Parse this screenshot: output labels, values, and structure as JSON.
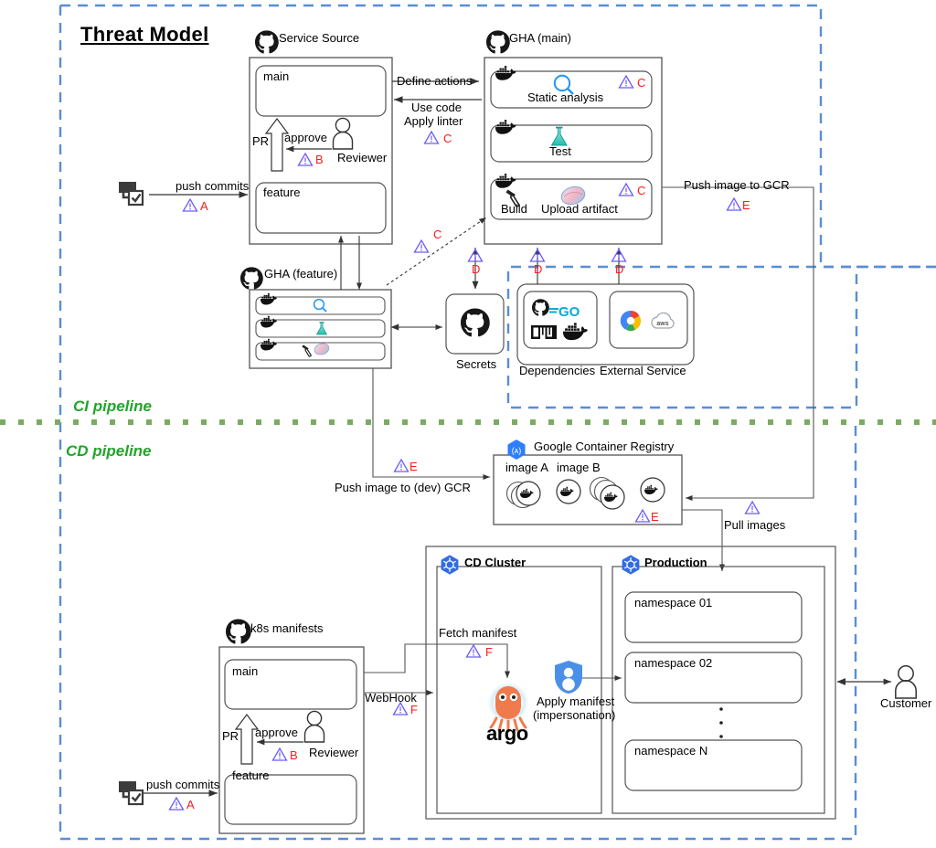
{
  "diagram": {
    "title": "Threat Model",
    "pipelines": [
      {
        "id": "ci",
        "label": "CI pipeline"
      },
      {
        "id": "cd",
        "label": "CD pipeline"
      }
    ],
    "colors": {
      "trust_boundary": "#5b8cd6",
      "pipeline_divider": "#7aab62",
      "pipeline_label": "#22a52a",
      "threat_marker": "#6a5cff",
      "threat_letter": "#ff1a1a",
      "box_stroke": "#555555",
      "kubernetes_blue": "#326ce5",
      "argo_orange": "#ef7b4d",
      "shield_blue": "#4a90e8",
      "docker_blue": "#1d91d0",
      "go_cyan": "#00add8"
    }
  },
  "groups": {
    "service_source": {
      "icon": "github-icon",
      "label": "Service Source",
      "branches": [
        {
          "name": "main"
        },
        {
          "name": "feature"
        }
      ],
      "pr_label": "PR",
      "approve_label": "approve",
      "reviewer_label": "Reviewer",
      "threat": {
        "marker": "warning-triangle-icon",
        "letter": "B"
      }
    },
    "gha_main": {
      "icon": "github-icon",
      "label": "GHA (main)",
      "jobs": [
        {
          "runner": "docker-icon",
          "icon": "magnifier-icon",
          "label": "Static analysis",
          "threat": {
            "marker": "warning-triangle-icon",
            "letter": "C"
          }
        },
        {
          "runner": "docker-icon",
          "icon": "flask-icon",
          "label": "Test",
          "threat": null
        },
        {
          "runner": "docker-icon",
          "icon": "hammer-icon",
          "label": "Build",
          "icon2": "upload-artifact-icon",
          "label2": "Upload artifact",
          "threat": {
            "marker": "warning-triangle-icon",
            "letter": "C"
          }
        }
      ]
    },
    "gha_feature": {
      "icon": "github-icon",
      "label": "GHA (feature)",
      "jobs": [
        {
          "runner": "docker-icon",
          "icon": "magnifier-icon"
        },
        {
          "runner": "docker-icon",
          "icon": "flask-icon"
        },
        {
          "runner": "docker-icon",
          "icon": "hammer-icon",
          "icon2": "upload-artifact-icon"
        }
      ]
    },
    "secrets": {
      "icon": "github-icon",
      "label": "Secrets"
    },
    "dependencies": {
      "label": "Dependencies",
      "icons": [
        "github-icon",
        "golang-icon",
        "npm-icon",
        "docker-icon"
      ]
    },
    "external_service": {
      "label": "External Service",
      "icons": [
        "google-cloud-icon",
        "aws-cloud-icon"
      ]
    },
    "gcr": {
      "icon": "gcr-hexagon-icon",
      "label": "Google Container Registry",
      "image_labels": [
        "image A",
        "image B"
      ],
      "images": [
        "docker-image-stack-icon",
        "docker-image-icon",
        "docker-image-stack-icon",
        "docker-image-icon"
      ],
      "threat": {
        "marker": "warning-triangle-icon",
        "letter": "E"
      }
    },
    "cd_cluster": {
      "icon": "kubernetes-icon",
      "label": "CD Cluster",
      "argo_label": "argo",
      "argo_icon": "argo-octopus-icon"
    },
    "production": {
      "icon": "kubernetes-icon",
      "label": "Production",
      "namespaces": [
        {
          "name": "namespace 01"
        },
        {
          "name": "namespace 02"
        },
        {
          "name": "namespace N"
        }
      ],
      "ellipsis": "⋮"
    },
    "k8s_manifests": {
      "icon": "github-icon",
      "label": "k8s manifests",
      "branches": [
        {
          "name": "main"
        },
        {
          "name": "feature"
        }
      ],
      "pr_label": "PR",
      "approve_label": "approve",
      "reviewer_label": "Reviewer",
      "threat": {
        "marker": "warning-triangle-icon",
        "letter": "B"
      }
    },
    "customer": {
      "icon": "person-icon",
      "label": "Customer"
    },
    "dev_workstation_top": {
      "icon": "workstation-icon"
    },
    "dev_workstation_bottom": {
      "icon": "workstation-icon"
    }
  },
  "flows": [
    {
      "id": "push-commits-top",
      "label": "push commits",
      "threat": {
        "marker": "warning-triangle-icon",
        "letter": "A"
      }
    },
    {
      "id": "define-actions",
      "label": "Define actions",
      "threat": null
    },
    {
      "id": "use-code-apply-linter",
      "label": "Use code\nApply linter",
      "label_line1": "Use code",
      "label_line2": "Apply linter",
      "threat": {
        "marker": "warning-triangle-icon",
        "letter": "C"
      }
    },
    {
      "id": "feature-pipeline-trigger",
      "label": "",
      "threat": {
        "marker": "warning-triangle-icon",
        "letter": "C"
      }
    },
    {
      "id": "secrets-access",
      "label": "",
      "threat": {
        "marker": "warning-triangle-icon",
        "letter": "D"
      }
    },
    {
      "id": "deps-access",
      "label": "",
      "threat": {
        "marker": "warning-triangle-icon",
        "letter": "D"
      }
    },
    {
      "id": "external-access",
      "label": "",
      "threat": {
        "marker": "warning-triangle-icon",
        "letter": "D"
      }
    },
    {
      "id": "push-image-to-gcr",
      "label": "Push image to GCR",
      "threat": {
        "marker": "warning-triangle-icon",
        "letter": "E"
      }
    },
    {
      "id": "push-image-to-dev-gcr",
      "label": "Push image to (dev) GCR",
      "threat": {
        "marker": "warning-triangle-icon",
        "letter": "E"
      }
    },
    {
      "id": "pull-images",
      "label": "Pull images",
      "threat": {
        "marker": "warning-triangle-icon",
        "letter": ""
      }
    },
    {
      "id": "fetch-manifest",
      "label": "Fetch manifest",
      "threat": {
        "marker": "warning-triangle-icon",
        "letter": "F"
      }
    },
    {
      "id": "webhook",
      "label": "WebHook",
      "threat": {
        "marker": "warning-triangle-icon",
        "letter": "F"
      }
    },
    {
      "id": "apply-manifest",
      "label_line1": "Apply manifest",
      "label_line2": "(impersonation)",
      "icon": "shield-user-icon",
      "threat": null
    },
    {
      "id": "push-commits-bottom",
      "label": "push commits",
      "threat": {
        "marker": "warning-triangle-icon",
        "letter": "A"
      }
    }
  ]
}
